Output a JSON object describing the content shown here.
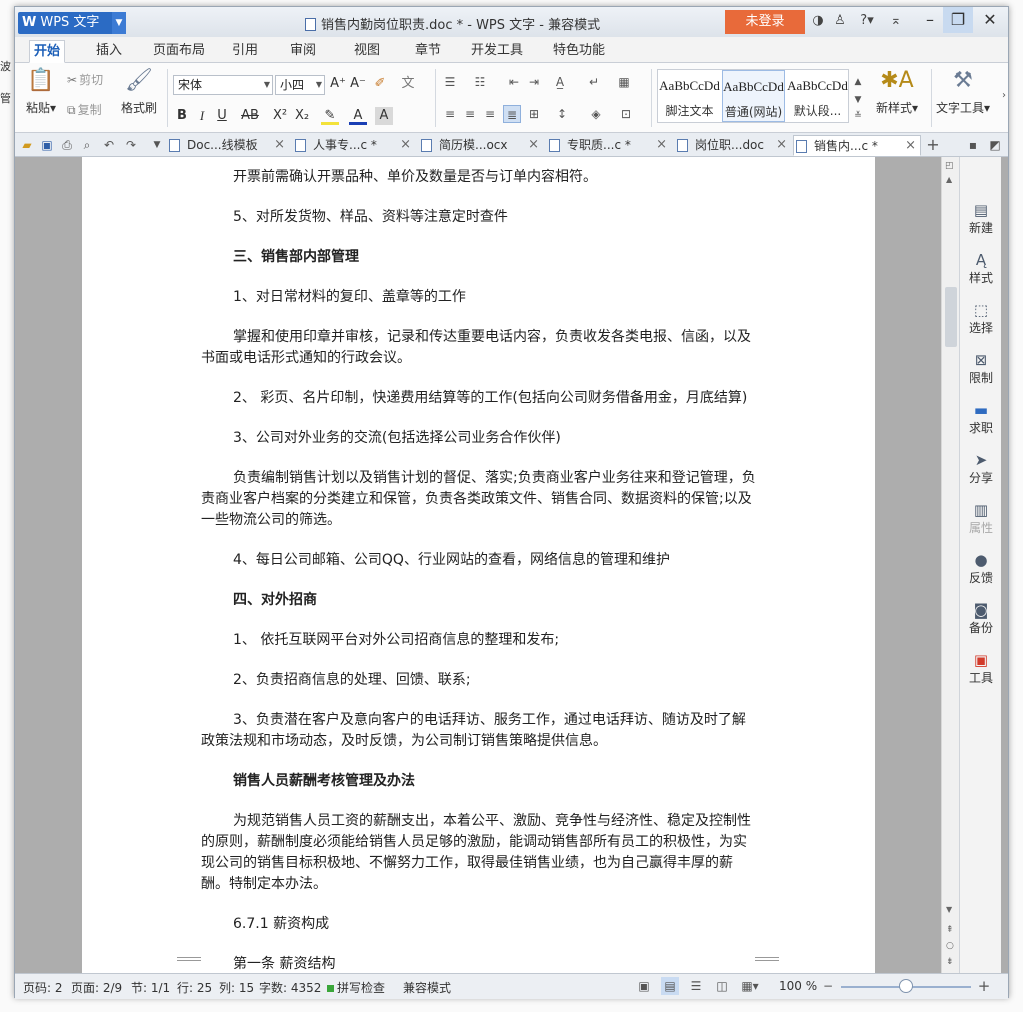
{
  "window": {
    "app_menu": "WPS 文字",
    "title": "销售内勤岗位职责.doc * - WPS 文字 - 兼容模式",
    "login_label": "未登录",
    "help_label": "?"
  },
  "menu_tabs": [
    "开始",
    "插入",
    "页面布局",
    "引用",
    "审阅",
    "视图",
    "章节",
    "开发工具",
    "特色功能"
  ],
  "ribbon": {
    "paste": "粘贴",
    "cut": "剪切",
    "copy": "复制",
    "format_painter": "格式刷",
    "font_name": "宋体",
    "font_size": "小四",
    "styles": [
      {
        "preview": "AaBbCcDd",
        "name": "脚注文本"
      },
      {
        "preview": "AaBbCcDd",
        "name": "普通(网站)"
      },
      {
        "preview": "AaBbCcDd",
        "name": "默认段..."
      }
    ],
    "new_style": "新样式",
    "text_tools": "文字工具"
  },
  "doc_tabs": [
    {
      "label": "Doc...线模板",
      "active": false
    },
    {
      "label": "人事专...c *",
      "active": false
    },
    {
      "label": "简历模...ocx",
      "active": false
    },
    {
      "label": "专职质...c *",
      "active": false
    },
    {
      "label": "岗位职...doc",
      "active": false
    },
    {
      "label": "销售内...c *",
      "active": true
    }
  ],
  "document": {
    "paragraphs": [
      {
        "text": "开票前需确认开票品种、单价及数量是否与订单内容相符。",
        "bold": false
      },
      {
        "text": "5、对所发货物、样品、资料等注意定时查件",
        "bold": false
      },
      {
        "text": "三、销售部内部管理",
        "bold": true
      },
      {
        "text": "1、对日常材料的复印、盖章等的工作",
        "bold": false
      },
      {
        "text": "掌握和使用印章并审核，记录和传达重要电话内容，负责收发各类电报、信函，以及书面或电话形式通知的行政会议。",
        "bold": false
      },
      {
        "text": "2、 彩页、名片印制，快递费用结算等的工作(包括向公司财务借备用金，月底结算)",
        "bold": false
      },
      {
        "text": "3、公司对外业务的交流(包括选择公司业务合作伙伴)",
        "bold": false
      },
      {
        "text": "负责编制销售计划以及销售计划的督促、落实;负责商业客户业务往来和登记管理，负责商业客户档案的分类建立和保管，负责各类政策文件、销售合同、数据资料的保管;以及一些物流公司的筛选。",
        "bold": false
      },
      {
        "text": "4、每日公司邮箱、公司QQ、行业网站的查看，网络信息的管理和维护",
        "bold": false
      },
      {
        "text": "四、对外招商",
        "bold": true
      },
      {
        "text": "1、 依托互联网平台对外公司招商信息的整理和发布;",
        "bold": false
      },
      {
        "text": "2、负责招商信息的处理、回馈、联系;",
        "bold": false
      },
      {
        "text": "3、负责潜在客户及意向客户的电话拜访、服务工作，通过电话拜访、随访及时了解政策法规和市场动态，及时反馈，为公司制订销售策略提供信息。",
        "bold": false
      },
      {
        "text": "销售人员薪酬考核管理及办法",
        "bold": true
      },
      {
        "text": "为规范销售人员工资的薪酬支出，本着公平、激励、竞争性与经济性、稳定及控制性的原则，薪酬制度必须能给销售人员足够的激励，能调动销售部所有员工的积极性，为实现公司的销售目标积极地、不懈努力工作，取得最佳销售业绩，也为自己赢得丰厚的薪酬。特制定本办法。",
        "bold": false
      },
      {
        "text": "6.7.1 薪资构成",
        "bold": false
      },
      {
        "text": "第一条 薪资结构",
        "bold": false
      }
    ]
  },
  "side_panel": [
    "新建",
    "样式",
    "选择",
    "限制",
    "求职",
    "分享",
    "属性",
    "反馈",
    "备份",
    "工具"
  ],
  "status": {
    "page_num": "页码: 2",
    "pages": "页面: 2/9",
    "section": "节: 1/1",
    "row": "行: 25",
    "col": "列: 15",
    "words": "字数: 4352",
    "spell": "拼写检查",
    "mode": "兼容模式",
    "zoom": "100 %",
    "zoom_fraction": 0.5
  }
}
